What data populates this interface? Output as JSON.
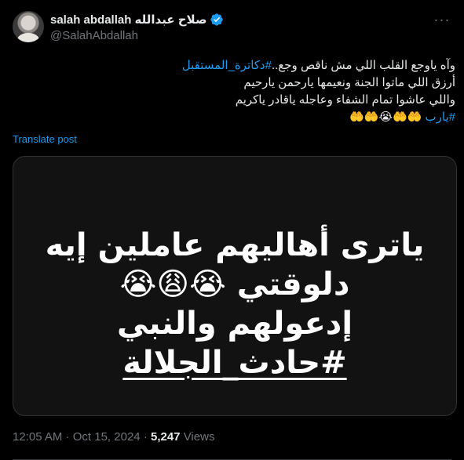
{
  "post": {
    "author": {
      "display_name": "salah abdallah صلاح عبدالله",
      "handle": "@SalahAbdallah",
      "verified": true
    },
    "text_lines": [
      {
        "text": "وآه ياوجع القلب اللي مش ناقص وجع..",
        "hashtag": "#دكاترة_المستقبل"
      },
      {
        "text": "أرزق اللي ماتوا الجنة ونعيمها يارحمن يارحيم"
      },
      {
        "text": "واللي عاشوا تمام الشفاء وعاجله ياقادر ياكريم"
      },
      {
        "hashtag": "#يارب",
        "emojis": "🤲🤲😭🤲🤲"
      }
    ],
    "translate_label": "Translate post",
    "media": {
      "lines": [
        "ياترى أهاليهم عاملين إيه",
        "دلوقتي 😭😩😭",
        "إدعولهم والنبي",
        "#حادث_الجلالة"
      ]
    },
    "meta": {
      "time": "12:05 AM",
      "separator": "·",
      "date": "Oct 15, 2024",
      "views_count": "5,247",
      "views_label": "Views"
    }
  },
  "icons": {
    "verified": "verified-badge-icon",
    "more": "more-options-icon"
  },
  "colors": {
    "background": "#000000",
    "text": "#e7e9ea",
    "secondary": "#71767b",
    "link": "#1d9bf0",
    "media_bg": "#121212",
    "border": "#2f3336"
  }
}
